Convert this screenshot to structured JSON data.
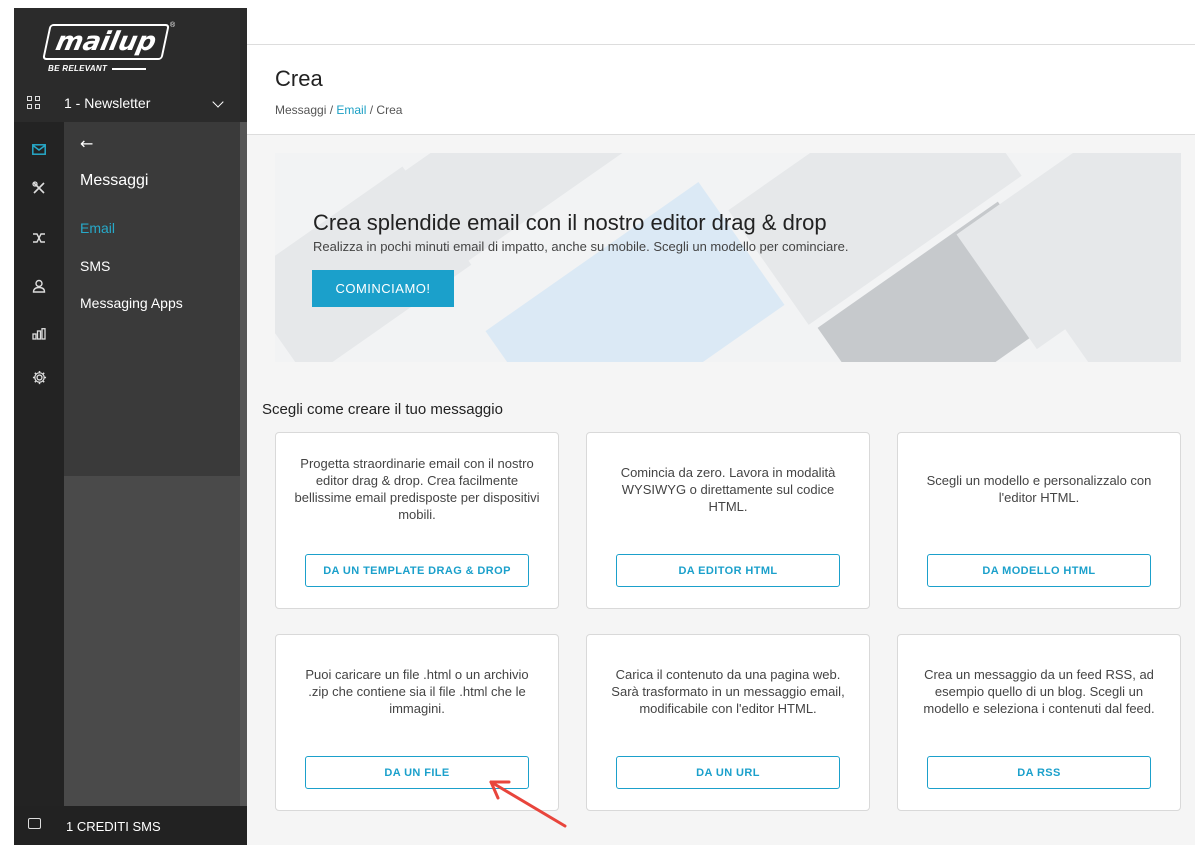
{
  "brand": {
    "logo_text": "mailup",
    "tagline": "BE RELEVANT",
    "reg_mark": "®"
  },
  "list_selector": {
    "label": "1 - Newsletter"
  },
  "icon_rail": [
    "mail-icon",
    "tools-icon",
    "shuffle-icon",
    "user-icon",
    "stats-icon",
    "settings-icon"
  ],
  "subnav": {
    "back": "←",
    "title": "Messaggi",
    "items": [
      {
        "label": "Email",
        "active": true
      },
      {
        "label": "SMS",
        "active": false
      },
      {
        "label": "Messaging Apps",
        "active": false
      }
    ]
  },
  "footer": {
    "credits": "1 CREDITI SMS"
  },
  "header": {
    "title": "Crea",
    "breadcrumb": {
      "root": "Messaggi",
      "sep": " / ",
      "link": "Email",
      "current": "Crea"
    }
  },
  "banner": {
    "headline": "Crea splendide email con il nostro editor drag & drop",
    "subtitle": "Realizza in pochi minuti email di impatto, anche su mobile. Scegli un modello per cominciare.",
    "cta": "COMINCIAMO!"
  },
  "section_title": "Scegli come creare il tuo messaggio",
  "cards": [
    {
      "description": "Progetta straordinarie email con il nostro editor drag & drop. Crea facilmente bellissime email predisposte per dispositivi mobili.",
      "button": "DA UN TEMPLATE DRAG & DROP"
    },
    {
      "description": "Comincia da zero. Lavora in modalità WYSIWYG o direttamente sul codice HTML.",
      "button": "DA EDITOR HTML"
    },
    {
      "description": "Scegli un modello e personalizzalo con l'editor HTML.",
      "button": "DA MODELLO HTML"
    },
    {
      "description": "Puoi caricare un file .html o un archivio .zip che contiene sia il file .html che le immagini.",
      "button": "DA UN FILE"
    },
    {
      "description": "Carica il contenuto da una pagina web. Sarà trasformato in un messaggio email, modificabile con l'editor HTML.",
      "button": "DA UN URL"
    },
    {
      "description": "Crea un messaggio da un feed RSS, ad esempio quello di un blog. Scegli un modello e seleziona i contenuti dal feed.",
      "button": "DA RSS"
    }
  ],
  "colors": {
    "accent": "#1ba0cb",
    "sidebar_dark": "#2b2b2b",
    "annotation_arrow": "#e8453c"
  }
}
